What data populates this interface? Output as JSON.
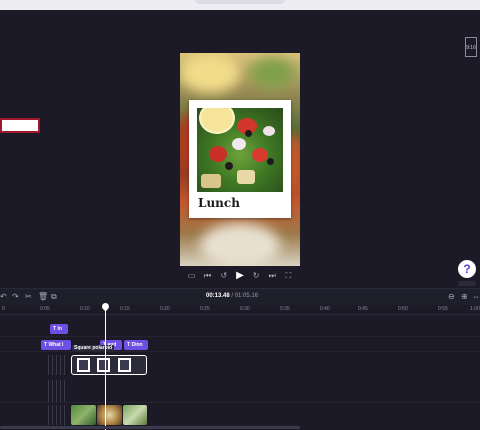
{
  "preview": {
    "caption": "Lunch",
    "aspect_ratio": "9:16"
  },
  "player": {
    "controls": [
      "hide-captions-icon",
      "skip-back-icon",
      "rewind-5-icon",
      "play-icon",
      "forward-5-icon",
      "skip-forward-icon",
      "fullscreen-icon"
    ]
  },
  "help": {
    "label": "?"
  },
  "timeline": {
    "current_time": "00:13.48",
    "total_time": "/ 01:05.16",
    "ruler_ticks": [
      "0",
      "0:05",
      "0:10",
      "0:15",
      "0:20",
      "0:25",
      "0:30",
      "0:35",
      "0:40",
      "0:45",
      "0:50",
      "0:55",
      "1:00"
    ],
    "text_clips_row1": [
      {
        "label": "In"
      }
    ],
    "text_clips_row2": [
      {
        "label": "What l"
      },
      {
        "label": "and"
      },
      {
        "label": "Dinn"
      }
    ],
    "sticker_clip": {
      "label": "Square polaroid"
    }
  },
  "colors": {
    "background": "#1b1a26",
    "accent": "#6d4fe3",
    "field_border": "#a0162b"
  }
}
